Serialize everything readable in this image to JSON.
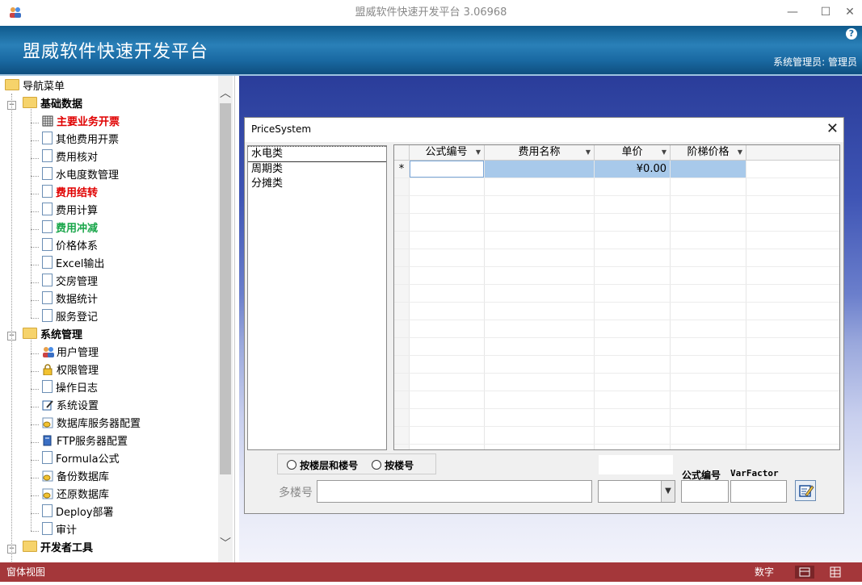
{
  "window": {
    "title": "盟威软件快速开发平台 3.06968",
    "minimize": "—",
    "maximize": "☐",
    "close": "✕"
  },
  "header": {
    "title": "盟威软件快速开发平台",
    "user": "系统管理员: 管理员",
    "help": "?"
  },
  "nav": {
    "root": "导航菜单",
    "groups": [
      {
        "label": "基础数据",
        "items": [
          {
            "label": "主要业务开票",
            "color": "#e00000",
            "bold": true,
            "icon": "grid-icon"
          },
          {
            "label": "其他费用开票",
            "icon": "document-icon"
          },
          {
            "label": "费用核对",
            "icon": "document-icon"
          },
          {
            "label": "水电度数管理",
            "icon": "document-icon"
          },
          {
            "label": "费用结转",
            "color": "#e00000",
            "bold": true,
            "icon": "document-icon"
          },
          {
            "label": "费用计算",
            "icon": "document-icon"
          },
          {
            "label": "费用冲减",
            "color": "#19a64a",
            "bold": true,
            "icon": "document-icon"
          },
          {
            "label": "价格体系",
            "icon": "document-icon"
          },
          {
            "label": "Excel输出",
            "icon": "document-icon"
          },
          {
            "label": "交房管理",
            "icon": "document-icon"
          },
          {
            "label": "数据统计",
            "icon": "document-icon"
          },
          {
            "label": "服务登记",
            "icon": "document-icon"
          }
        ]
      },
      {
        "label": "系统管理",
        "items": [
          {
            "label": "用户管理",
            "icon": "users-icon"
          },
          {
            "label": "权限管理",
            "icon": "lock-icon"
          },
          {
            "label": "操作日志",
            "icon": "document-icon"
          },
          {
            "label": "系统设置",
            "icon": "settings-icon"
          },
          {
            "label": "数据库服务器配置",
            "icon": "database-icon"
          },
          {
            "label": "FTP服务器配置",
            "icon": "server-icon"
          },
          {
            "label": "Formula公式",
            "icon": "document-icon"
          },
          {
            "label": "备份数据库",
            "icon": "database-icon"
          },
          {
            "label": "还原数据库",
            "icon": "database-icon"
          },
          {
            "label": "Deploy部署",
            "icon": "document-icon"
          },
          {
            "label": "审计",
            "icon": "document-icon"
          }
        ]
      },
      {
        "label": "开发者工具",
        "items": []
      }
    ]
  },
  "dialog": {
    "title": "PriceSystem",
    "close": "✕",
    "list": [
      "水电类",
      "周期类",
      "分摊类"
    ],
    "grid": {
      "columns": [
        "公式编号",
        "费用名称",
        "单价",
        "阶梯价格"
      ],
      "new_row_marker": "*",
      "new_row_price": "¥0.00"
    },
    "radio_floor_and_number": "按楼层和楼号",
    "radio_number": "按楼号",
    "multi_building_label": "多楼号",
    "formula_no_label": "公式编号",
    "varfactor_label": "VarFactor"
  },
  "status": {
    "left": "窗体视图",
    "right": "数字"
  }
}
